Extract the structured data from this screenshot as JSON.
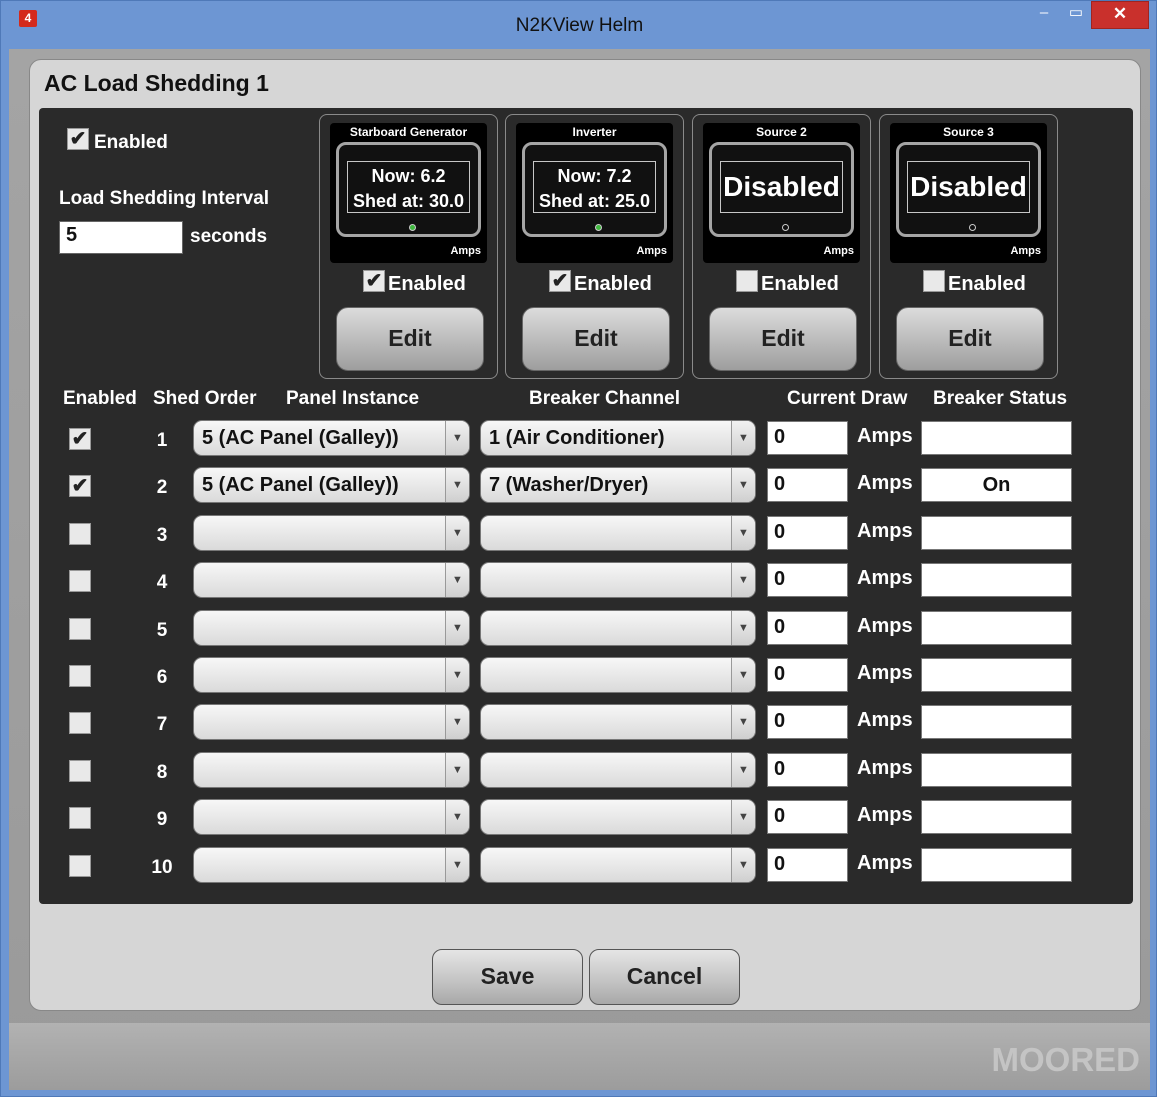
{
  "window": {
    "title": "N2KView Helm",
    "app_icon_glyph": "4",
    "minimize": "–",
    "maximize": "▭",
    "close": "✕"
  },
  "dialog": {
    "title": "AC Load Shedding 1"
  },
  "general": {
    "enabled_label": "Enabled",
    "enabled": true,
    "interval_label": "Load Shedding Interval",
    "interval_value": "5",
    "interval_unit": "seconds"
  },
  "sources": [
    {
      "title": "Starboard Generator",
      "line1": "Now: 6.2",
      "line2": "Shed at: 30.0",
      "disabled_text": "",
      "unit": "Amps",
      "enabled_label": "Enabled",
      "enabled": true,
      "edit_label": "Edit",
      "led_color": "#3fb83f"
    },
    {
      "title": "Inverter",
      "line1": "Now: 7.2",
      "line2": "Shed at: 25.0",
      "disabled_text": "",
      "unit": "Amps",
      "enabled_label": "Enabled",
      "enabled": true,
      "edit_label": "Edit",
      "led_color": "#3fb83f"
    },
    {
      "title": "Source 2",
      "line1": "",
      "line2": "",
      "disabled_text": "Disabled",
      "unit": "Amps",
      "enabled_label": "Enabled",
      "enabled": false,
      "edit_label": "Edit",
      "led_color": "#111111"
    },
    {
      "title": "Source 3",
      "line1": "",
      "line2": "",
      "disabled_text": "Disabled",
      "unit": "Amps",
      "enabled_label": "Enabled",
      "enabled": false,
      "edit_label": "Edit",
      "led_color": "#111111"
    }
  ],
  "table": {
    "headers": {
      "enabled": "Enabled",
      "shed_order": "Shed Order",
      "panel_instance": "Panel Instance",
      "breaker_channel": "Breaker Channel",
      "current_draw": "Current Draw",
      "breaker_status": "Breaker Status"
    },
    "amps_label": "Amps",
    "rows": [
      {
        "enabled": true,
        "order": "1",
        "panel": "5 (AC Panel (Galley))",
        "breaker": "1 (Air Conditioner)",
        "draw": "0",
        "status": ""
      },
      {
        "enabled": true,
        "order": "2",
        "panel": "5 (AC Panel (Galley))",
        "breaker": "7 (Washer/Dryer)",
        "draw": "0",
        "status": "On"
      },
      {
        "enabled": false,
        "order": "3",
        "panel": "",
        "breaker": "",
        "draw": "0",
        "status": ""
      },
      {
        "enabled": false,
        "order": "4",
        "panel": "",
        "breaker": "",
        "draw": "0",
        "status": ""
      },
      {
        "enabled": false,
        "order": "5",
        "panel": "",
        "breaker": "",
        "draw": "0",
        "status": ""
      },
      {
        "enabled": false,
        "order": "6",
        "panel": "",
        "breaker": "",
        "draw": "0",
        "status": ""
      },
      {
        "enabled": false,
        "order": "7",
        "panel": "",
        "breaker": "",
        "draw": "0",
        "status": ""
      },
      {
        "enabled": false,
        "order": "8",
        "panel": "",
        "breaker": "",
        "draw": "0",
        "status": ""
      },
      {
        "enabled": false,
        "order": "9",
        "panel": "",
        "breaker": "",
        "draw": "0",
        "status": ""
      },
      {
        "enabled": false,
        "order": "10",
        "panel": "",
        "breaker": "",
        "draw": "0",
        "status": ""
      }
    ]
  },
  "buttons": {
    "save": "Save",
    "cancel": "Cancel"
  },
  "status_bar": {
    "mode": "MOORED"
  }
}
